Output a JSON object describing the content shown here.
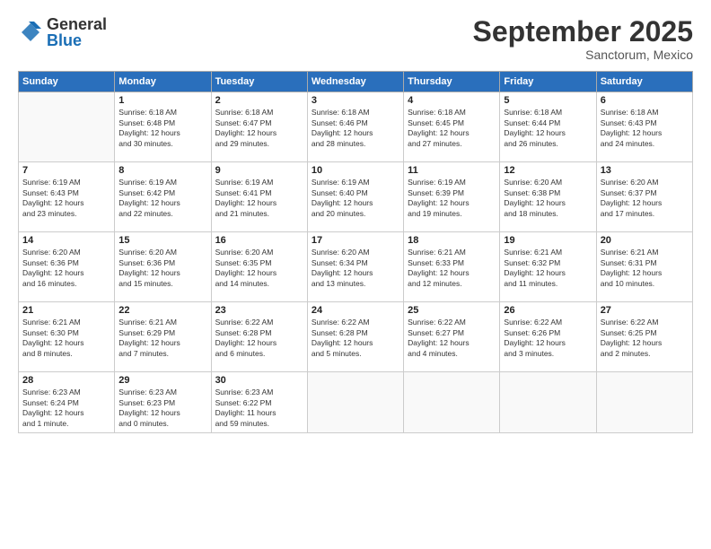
{
  "logo": {
    "general": "General",
    "blue": "Blue"
  },
  "header": {
    "month": "September 2025",
    "location": "Sanctorum, Mexico"
  },
  "weekdays": [
    "Sunday",
    "Monday",
    "Tuesday",
    "Wednesday",
    "Thursday",
    "Friday",
    "Saturday"
  ],
  "days": [
    {
      "date": "",
      "info": ""
    },
    {
      "date": "1",
      "info": "Sunrise: 6:18 AM\nSunset: 6:48 PM\nDaylight: 12 hours\nand 30 minutes."
    },
    {
      "date": "2",
      "info": "Sunrise: 6:18 AM\nSunset: 6:47 PM\nDaylight: 12 hours\nand 29 minutes."
    },
    {
      "date": "3",
      "info": "Sunrise: 6:18 AM\nSunset: 6:46 PM\nDaylight: 12 hours\nand 28 minutes."
    },
    {
      "date": "4",
      "info": "Sunrise: 6:18 AM\nSunset: 6:45 PM\nDaylight: 12 hours\nand 27 minutes."
    },
    {
      "date": "5",
      "info": "Sunrise: 6:18 AM\nSunset: 6:44 PM\nDaylight: 12 hours\nand 26 minutes."
    },
    {
      "date": "6",
      "info": "Sunrise: 6:18 AM\nSunset: 6:43 PM\nDaylight: 12 hours\nand 24 minutes."
    },
    {
      "date": "7",
      "info": "Sunrise: 6:19 AM\nSunset: 6:43 PM\nDaylight: 12 hours\nand 23 minutes."
    },
    {
      "date": "8",
      "info": "Sunrise: 6:19 AM\nSunset: 6:42 PM\nDaylight: 12 hours\nand 22 minutes."
    },
    {
      "date": "9",
      "info": "Sunrise: 6:19 AM\nSunset: 6:41 PM\nDaylight: 12 hours\nand 21 minutes."
    },
    {
      "date": "10",
      "info": "Sunrise: 6:19 AM\nSunset: 6:40 PM\nDaylight: 12 hours\nand 20 minutes."
    },
    {
      "date": "11",
      "info": "Sunrise: 6:19 AM\nSunset: 6:39 PM\nDaylight: 12 hours\nand 19 minutes."
    },
    {
      "date": "12",
      "info": "Sunrise: 6:20 AM\nSunset: 6:38 PM\nDaylight: 12 hours\nand 18 minutes."
    },
    {
      "date": "13",
      "info": "Sunrise: 6:20 AM\nSunset: 6:37 PM\nDaylight: 12 hours\nand 17 minutes."
    },
    {
      "date": "14",
      "info": "Sunrise: 6:20 AM\nSunset: 6:36 PM\nDaylight: 12 hours\nand 16 minutes."
    },
    {
      "date": "15",
      "info": "Sunrise: 6:20 AM\nSunset: 6:36 PM\nDaylight: 12 hours\nand 15 minutes."
    },
    {
      "date": "16",
      "info": "Sunrise: 6:20 AM\nSunset: 6:35 PM\nDaylight: 12 hours\nand 14 minutes."
    },
    {
      "date": "17",
      "info": "Sunrise: 6:20 AM\nSunset: 6:34 PM\nDaylight: 12 hours\nand 13 minutes."
    },
    {
      "date": "18",
      "info": "Sunrise: 6:21 AM\nSunset: 6:33 PM\nDaylight: 12 hours\nand 12 minutes."
    },
    {
      "date": "19",
      "info": "Sunrise: 6:21 AM\nSunset: 6:32 PM\nDaylight: 12 hours\nand 11 minutes."
    },
    {
      "date": "20",
      "info": "Sunrise: 6:21 AM\nSunset: 6:31 PM\nDaylight: 12 hours\nand 10 minutes."
    },
    {
      "date": "21",
      "info": "Sunrise: 6:21 AM\nSunset: 6:30 PM\nDaylight: 12 hours\nand 8 minutes."
    },
    {
      "date": "22",
      "info": "Sunrise: 6:21 AM\nSunset: 6:29 PM\nDaylight: 12 hours\nand 7 minutes."
    },
    {
      "date": "23",
      "info": "Sunrise: 6:22 AM\nSunset: 6:28 PM\nDaylight: 12 hours\nand 6 minutes."
    },
    {
      "date": "24",
      "info": "Sunrise: 6:22 AM\nSunset: 6:28 PM\nDaylight: 12 hours\nand 5 minutes."
    },
    {
      "date": "25",
      "info": "Sunrise: 6:22 AM\nSunset: 6:27 PM\nDaylight: 12 hours\nand 4 minutes."
    },
    {
      "date": "26",
      "info": "Sunrise: 6:22 AM\nSunset: 6:26 PM\nDaylight: 12 hours\nand 3 minutes."
    },
    {
      "date": "27",
      "info": "Sunrise: 6:22 AM\nSunset: 6:25 PM\nDaylight: 12 hours\nand 2 minutes."
    },
    {
      "date": "28",
      "info": "Sunrise: 6:23 AM\nSunset: 6:24 PM\nDaylight: 12 hours\nand 1 minute."
    },
    {
      "date": "29",
      "info": "Sunrise: 6:23 AM\nSunset: 6:23 PM\nDaylight: 12 hours\nand 0 minutes."
    },
    {
      "date": "30",
      "info": "Sunrise: 6:23 AM\nSunset: 6:22 PM\nDaylight: 11 hours\nand 59 minutes."
    },
    {
      "date": "",
      "info": ""
    },
    {
      "date": "",
      "info": ""
    },
    {
      "date": "",
      "info": ""
    },
    {
      "date": "",
      "info": ""
    }
  ]
}
